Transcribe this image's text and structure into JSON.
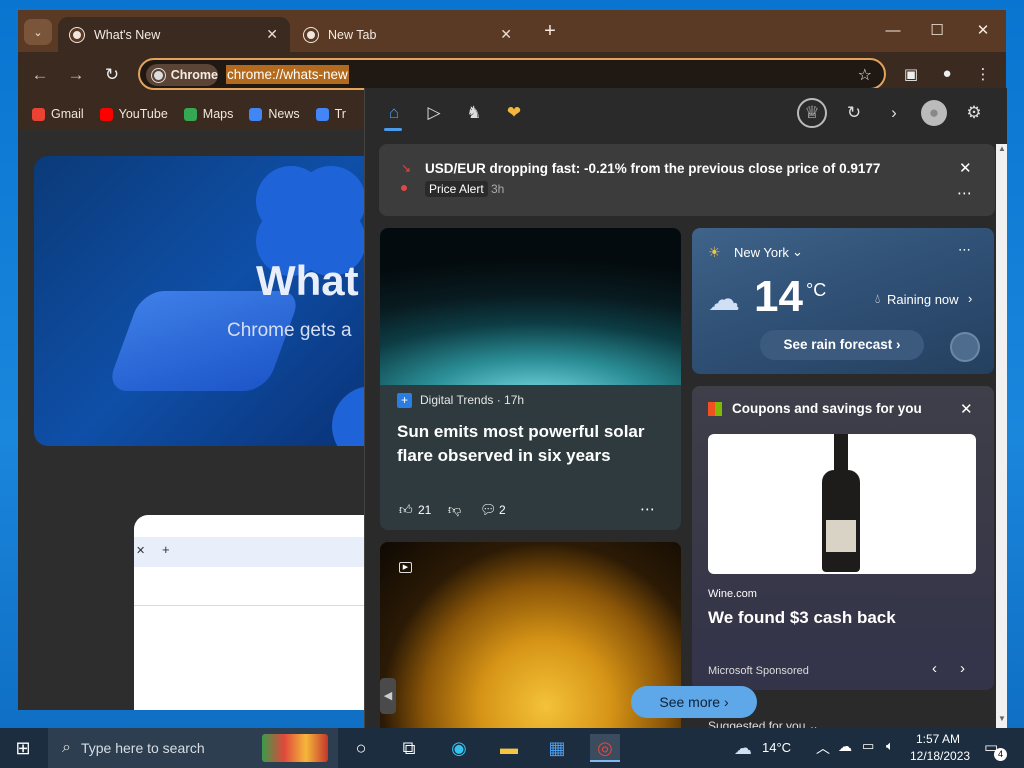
{
  "chrome": {
    "tabs": [
      {
        "label": "What's New",
        "active": true
      },
      {
        "label": "New Tab",
        "active": false
      }
    ],
    "omnibox": {
      "chip_label": "Chrome",
      "url": "chrome://whats-new"
    },
    "bookmarks": [
      {
        "label": "Gmail",
        "icon": "gmail-icon",
        "color": "#ea4335"
      },
      {
        "label": "YouTube",
        "icon": "youtube-icon",
        "color": "#ff0000"
      },
      {
        "label": "Maps",
        "icon": "maps-icon",
        "color": "#34a853"
      },
      {
        "label": "News",
        "icon": "news-icon",
        "color": "#4285f4"
      },
      {
        "label": "Tr",
        "icon": "translate-icon",
        "color": "#4285f4"
      }
    ],
    "page": {
      "hero_title": "What",
      "hero_subtitle": "Chrome gets a"
    }
  },
  "widgets": {
    "alert": {
      "title": "USD/EUR dropping fast: -0.21% from the previous close price of 0.9177",
      "tag": "Price Alert",
      "time": "3h"
    },
    "news1": {
      "source": "Digital Trends · 17h",
      "headline": "Sun emits most powerful solar flare observed in six years",
      "likes": "21",
      "comments": "2"
    },
    "weather": {
      "location": "New York",
      "temp": "14",
      "unit": "°C",
      "condition": "Raining now",
      "forecast_label": "See rain forecast"
    },
    "coupons": {
      "title": "Coupons and savings for you",
      "source": "Wine.com",
      "headline": "We found $3 cash back",
      "sponsor": "Microsoft Sponsored"
    },
    "see_more": "See more",
    "suggested": "Suggested for you"
  },
  "taskbar": {
    "search_placeholder": "Type here to search",
    "weather_temp": "14°C",
    "time": "1:57 AM",
    "date": "12/18/2023",
    "notifications": "4"
  },
  "colors": {
    "accent": "#4a9be9",
    "omnibox_border": "#e3a35a",
    "alert_red": "#e04848"
  }
}
